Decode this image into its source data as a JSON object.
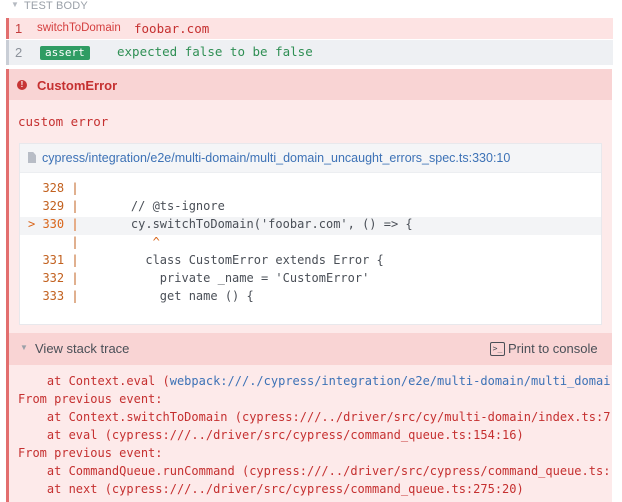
{
  "header": {
    "label": "TEST BODY"
  },
  "commands": [
    {
      "number": "1",
      "name": "switchToDomain",
      "message": "foobar.com"
    },
    {
      "number": "2",
      "name": "assert",
      "message_parts": [
        "expected",
        "false",
        "to be",
        "false"
      ]
    }
  ],
  "error": {
    "title": "CustomError",
    "message": "custom error",
    "file_path": "cypress/integration/e2e/multi-domain/multi_domain_uncaught_errors_spec.ts:330:10",
    "code_lines": [
      {
        "gutter": "  328 |",
        "text": ""
      },
      {
        "gutter": "  329 |",
        "text": "    // @ts-ignore"
      },
      {
        "gutter": "> 330 |",
        "text": "    cy.switchToDomain('foobar.com', () => {"
      },
      {
        "gutter": "      |",
        "text": "       ^"
      },
      {
        "gutter": "  331 |",
        "text": "      class CustomError extends Error {"
      },
      {
        "gutter": "  332 |",
        "text": "        private _name = 'CustomError'"
      },
      {
        "gutter": "  333 |",
        "text": "        get name () {"
      }
    ]
  },
  "stack": {
    "toggle_label": "View stack trace",
    "print_label": "Print to console",
    "print_icon": ">_",
    "lines": [
      {
        "prefix": "    at Context.eval (",
        "link": "webpack:///./cypress/integration/e2e/multi-domain/multi_domai",
        "suffix": ""
      },
      {
        "prefix": "From previous event:",
        "link": "",
        "suffix": ""
      },
      {
        "prefix": "    at Context.switchToDomain (cypress:///../driver/src/cy/multi-domain/index.ts:7",
        "link": "",
        "suffix": ""
      },
      {
        "prefix": "    at eval (cypress:///../driver/src/cypress/command_queue.ts:154:16)",
        "link": "",
        "suffix": ""
      },
      {
        "prefix": "From previous event:",
        "link": "",
        "suffix": ""
      },
      {
        "prefix": "    at CommandQueue.runCommand (cypress:///../driver/src/cypress/command_queue.ts:",
        "link": "",
        "suffix": ""
      },
      {
        "prefix": "    at next (cypress:///../driver/src/cypress/command_queue.ts:275:20)",
        "link": "",
        "suffix": ""
      }
    ]
  },
  "colors": {
    "error_red": "#c53030",
    "link_blue": "#3d72b6",
    "assert_green": "#2f9c63"
  }
}
